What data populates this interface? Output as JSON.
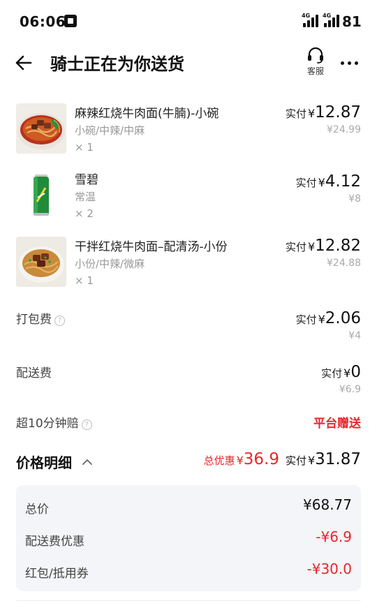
{
  "status_bar": {
    "time": "06:06",
    "network_label": "4G",
    "battery": "81"
  },
  "nav": {
    "title": "骑士正在为你送货",
    "service_label": "客服"
  },
  "items": [
    {
      "name": "麻辣红烧牛肉面(牛腩)-小碗",
      "spec": "小碗/中辣/中麻",
      "qty": "× 1",
      "paid_label": "实付",
      "currency": "¥",
      "paid": "12.87",
      "original": "¥24.99"
    },
    {
      "name": "雪碧",
      "spec": "常温",
      "qty": "× 2",
      "paid_label": "实付",
      "currency": "¥",
      "paid": "4.12",
      "original": "¥8"
    },
    {
      "name": "干拌红烧牛肉面–配清汤-小份",
      "spec": "小份/中辣/微麻",
      "qty": "× 1",
      "paid_label": "实付",
      "currency": "¥",
      "paid": "12.82",
      "original": "¥24.88"
    }
  ],
  "fees": {
    "packing": {
      "label": "打包费",
      "paid_label": "实付",
      "currency": "¥",
      "paid": "2.06",
      "original": "¥4"
    },
    "delivery": {
      "label": "配送费",
      "paid_label": "实付",
      "currency": "¥",
      "paid": "0",
      "original": "¥6.9"
    },
    "late_comp": {
      "label": "超10分钟赔",
      "value": "平台赠送"
    }
  },
  "summary": {
    "title": "价格明细",
    "discount_label": "总优惠",
    "currency": "¥",
    "discount": "36.9",
    "paid_label": "实付",
    "paid": "31.87"
  },
  "details": [
    {
      "label": "总价",
      "value": "¥68.77",
      "negative": false
    },
    {
      "label": "配送费优惠",
      "value": "-¥6.9",
      "negative": true
    },
    {
      "label": "红包/抵用券",
      "value": "-¥30.0",
      "negative": true
    }
  ],
  "colors": {
    "accent_red": "#e8262b",
    "detail_bg": "#f3f5f8"
  },
  "icons": {
    "back": "arrow-left-icon",
    "service": "headset-icon",
    "more": "more-dots-icon",
    "help": "question-circle-icon",
    "collapse": "chevron-up-icon"
  }
}
